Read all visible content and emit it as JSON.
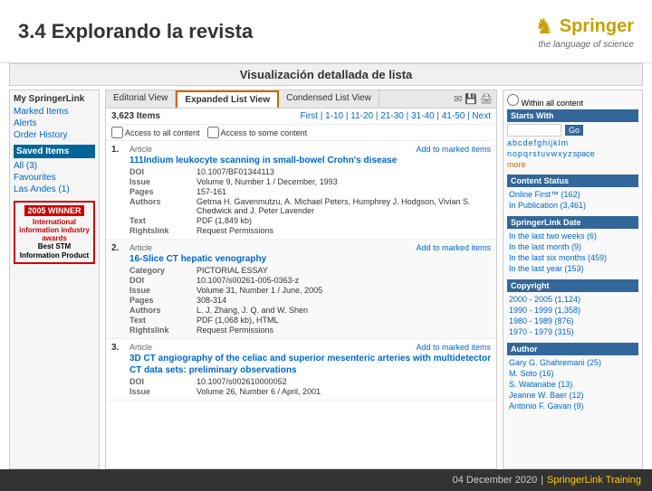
{
  "header": {
    "title": "3.4 Explorando la revista",
    "springer_brand": "Springer",
    "springer_tagline": "the language of science"
  },
  "viz_label": "Visualización detallada de lista",
  "tabs": [
    {
      "label": "Editorial View",
      "active": false
    },
    {
      "label": "Expanded List View",
      "active": true
    },
    {
      "label": "Condensed List View",
      "active": false
    }
  ],
  "results": {
    "count": "3,623 Items",
    "pagination": "First | 1-10 | 11-20 | 21-30 | 31-40 | 41-50 | Next"
  },
  "access_options": [
    "Access to all content",
    "Access to some content"
  ],
  "articles": [
    {
      "num": "1.",
      "type": "Article",
      "title": "111Indium leukocyte scanning in small-bowel Crohn's disease",
      "add_marked": "Add to marked items",
      "doi": "10.1007/BF01344113",
      "issue": "Volume 9, Number 1 / December, 1993",
      "pages": "157-161",
      "authors": "Getrna H. Gavenmutzu, A. Michael Peters, Humphrey J. Hodgson, Vivian S. Chedwick and J. Peter Lavender",
      "text": "PDF (1,849 kb)",
      "rightslink": "Request Permissions"
    },
    {
      "num": "2.",
      "type": "Article",
      "title": "16-Slice CT hepatic venography",
      "add_marked": "Add to marked items",
      "category": "PICTORIAL ESSAY",
      "doi": "10.1007/s00261-005-0363-z",
      "issue": "Volume 31, Number 1 / June, 2005",
      "pages": "308-314",
      "authors": "L. J. Zhang, J. Q. and W. Shen",
      "text": "PDF (1,068 kb), HTML",
      "rightslink": "Request Permissions"
    },
    {
      "num": "3.",
      "type": "Article",
      "title": "3D CT angiography of the celiac and superior mesenteric arteries with multidetector CT data sets: preliminary observations",
      "add_marked": "Add to marked items",
      "doi": "10.1007/s002610000052",
      "issue": "Volume 26, Number 6 / April, 2001"
    }
  ],
  "sidebar": {
    "title": "My SpringerLink",
    "items": [
      "Marked Items",
      "Alerts",
      "Order History"
    ],
    "saved_label": "Saved Items",
    "saved_items": [
      "All (3)",
      "Favourites",
      "Las Andes (1)"
    ],
    "award": {
      "year": "2005 WINNER",
      "org": "International information industry awards",
      "product": "Best STM Information Product"
    }
  },
  "right_sidebar": {
    "sections": [
      {
        "title": "Within all content",
        "label": "Starts With",
        "alphabet": [
          "a",
          "b",
          "c",
          "d",
          "e",
          "f",
          "g",
          "h",
          "i",
          "j",
          "k",
          "l",
          "m",
          "n",
          "o",
          "p",
          "q",
          "r",
          "s",
          "t",
          "u",
          "v",
          "w",
          "x",
          "y",
          "z",
          "space"
        ],
        "go": "Go",
        "more": "more"
      },
      {
        "title": "Content Status",
        "items": [
          "Online First™ (162)",
          "In Publication (3,461)"
        ]
      },
      {
        "title": "SpringerLink Date",
        "items": [
          "In the last two weeks (6)",
          "In the last month (9)",
          "In the last six months (459)",
          "In the last year (153)"
        ]
      },
      {
        "title": "Copyright",
        "items": [
          "2000 - 2005 (1,124)",
          "1990 - 1999 (1,358)",
          "1980 - 1989 (876)",
          "1970 - 1979 (315)"
        ]
      },
      {
        "title": "Author",
        "items": [
          "Gary G. Ghahremani (25)",
          "M. Soto (16)",
          "S. Watanabe (13)",
          "Jeanne W. Baer (12)",
          "Antonio F. Gavan (9)"
        ]
      }
    ]
  },
  "footer": {
    "date": "04 December 2020",
    "separator": "|",
    "training": "SpringerLink Training"
  }
}
